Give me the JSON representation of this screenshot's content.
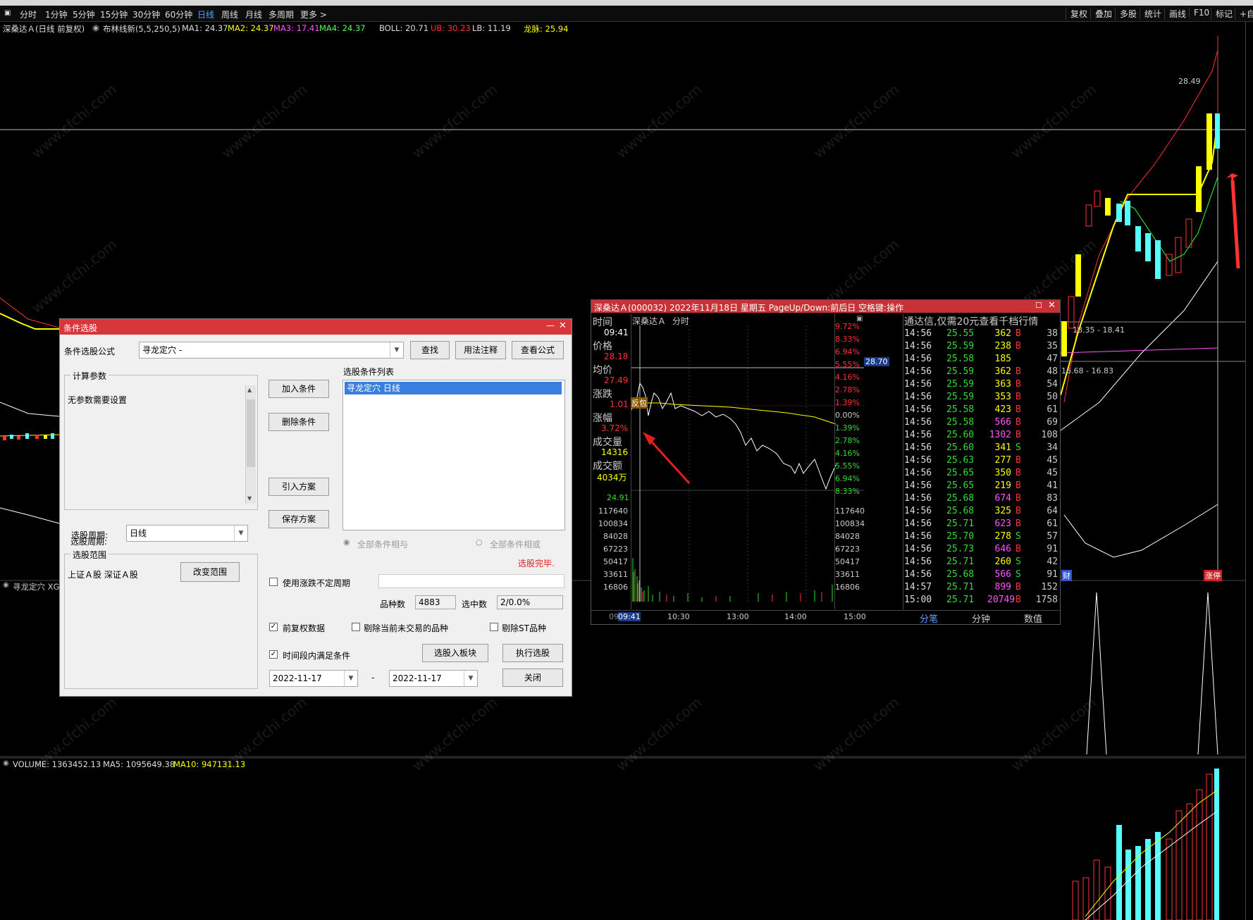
{
  "periods": [
    "分时",
    "1分钟",
    "5分钟",
    "15分钟",
    "30分钟",
    "60分钟",
    "日线",
    "周线",
    "月线",
    "多周期",
    "更多 >"
  ],
  "active_period": "日线",
  "right_tools": [
    "复权",
    "叠加",
    "多股",
    "统计",
    "画线",
    "F10",
    "标记",
    "+自"
  ],
  "info": {
    "stock": "深桑达Ａ(日线 前复权)",
    "indicator": "布林线新(5,5,250,5)",
    "ma1": "MA1: 24.37",
    "ma2": "MA2: 24.37",
    "ma3": "MA3: 17.41",
    "ma4": "MA4: 24.37",
    "boll": "BOLL: 20.71",
    "ub": "UB: 30.23",
    "lb": "LB: 11.19",
    "longmai": "龙脉: 25.94"
  },
  "chart_labels": {
    "high_price": "28.49",
    "level1": "18.35 - 18.41",
    "level2": "16.68 - 16.83",
    "cai": "财",
    "zhangting": "涨停",
    "sub_title": "寻龙定穴 XG",
    "volume_line": "VOLUME: 1363452.13",
    "ma5": "MA5: 1095649.38",
    "ma10": "MA10: 947131.13"
  },
  "colors": {
    "up": "#ff3232",
    "down": "#54ffff",
    "ma_yellow": "#ffff00",
    "dialog_title": "#d7363b"
  },
  "dialog": {
    "title": "条件选股",
    "formula_label": "条件选股公式",
    "formula_value": "寻龙定穴    -",
    "find": "查找",
    "usage": "用法注释",
    "view_formula": "查看公式",
    "params_title": "计算参数",
    "params_text": "无参数需要设置",
    "period_label": "选股周期:",
    "period_value": "日线",
    "range_title": "选股范围",
    "range_text": "上证Ａ股 深证Ａ股",
    "change_range": "改变范围",
    "add_cond": "加入条件",
    "del_cond": "删除条件",
    "import_plan": "引入方案",
    "save_plan": "保存方案",
    "cond_list_title": "选股条件列表",
    "cond_item": "寻龙定穴  日线",
    "radio_and": "全部条件相与",
    "radio_or": "全部条件相或",
    "done": "选股完毕.",
    "use_unfixed": "使用涨跌不定周期",
    "count_label": "品种数",
    "count_value": "4883",
    "selected_label": "选中数",
    "selected_value": "2/0.0%",
    "fq_data": "前复权数据",
    "exclude_untraded": "剔除当前未交易的品种",
    "exclude_st": "剔除ST品种",
    "to_block": "选股入板块",
    "execute": "执行选股",
    "period_meet": "时间段内满足条件",
    "date_from": "2022-11-17",
    "date_to": "2022-11-17",
    "close": "关闭"
  },
  "minute": {
    "title": "深桑达Ａ(000032) 2022年11月18日 星期五 PageUp/Down:前后日 空格键:操作",
    "name": "深桑达Ａ",
    "fenshi": "分时",
    "time_label": "时间",
    "time": "09:41",
    "price_label": "价格",
    "price": "28.18",
    "avg_label": "均价",
    "avg": "27.49",
    "chg_label": "涨跌",
    "chg": "1.01",
    "pct_label": "涨幅",
    "pct": "3.72%",
    "vol_label": "成交量",
    "vol": "14316",
    "amt_label": "成交额",
    "amt": "4034万",
    "left_price": "24.91",
    "vol_ticks": [
      "117640",
      "100834",
      "84028",
      "67223",
      "50417",
      "33611",
      "16806"
    ],
    "pct_ticks_up": [
      "9.72%",
      "8.33%",
      "6.94%",
      "5.55%",
      "4.16%",
      "2.78%",
      "1.39%"
    ],
    "zero_pct": "0.00%",
    "pct_ticks_down": [
      "1.39%",
      "2.78%",
      "4.16%",
      "5.55%",
      "6.94%",
      "8.33%"
    ],
    "cursor_price": "28.70",
    "times": [
      "09:41",
      "10:30",
      "13:00",
      "14:00",
      "15:00"
    ],
    "time_prefix": "09",
    "fanbao": "反包",
    "ad": "通达信,仅需20元查看千档行情",
    "ticks": [
      [
        "14:56",
        "25.55",
        "362",
        "B",
        "38"
      ],
      [
        "14:56",
        "25.59",
        "238",
        "B",
        "35"
      ],
      [
        "14:56",
        "25.58",
        "185",
        "",
        "47"
      ],
      [
        "14:56",
        "25.59",
        "362",
        "B",
        "48"
      ],
      [
        "14:56",
        "25.59",
        "363",
        "B",
        "54"
      ],
      [
        "14:56",
        "25.59",
        "353",
        "B",
        "50"
      ],
      [
        "14:56",
        "25.58",
        "423",
        "B",
        "61"
      ],
      [
        "14:56",
        "25.58",
        "566",
        "B",
        "69"
      ],
      [
        "14:56",
        "25.60",
        "1302",
        "B",
        "108"
      ],
      [
        "14:56",
        "25.60",
        "341",
        "S",
        "34"
      ],
      [
        "14:56",
        "25.63",
        "277",
        "B",
        "45"
      ],
      [
        "14:56",
        "25.65",
        "350",
        "B",
        "45"
      ],
      [
        "14:56",
        "25.65",
        "219",
        "B",
        "41"
      ],
      [
        "14:56",
        "25.68",
        "674",
        "B",
        "83"
      ],
      [
        "14:56",
        "25.68",
        "325",
        "B",
        "64"
      ],
      [
        "14:56",
        "25.71",
        "623",
        "B",
        "61"
      ],
      [
        "14:56",
        "25.70",
        "278",
        "S",
        "57"
      ],
      [
        "14:56",
        "25.73",
        "646",
        "B",
        "91"
      ],
      [
        "14:56",
        "25.71",
        "260",
        "S",
        "42"
      ],
      [
        "14:56",
        "25.68",
        "566",
        "S",
        "91"
      ],
      [
        "14:57",
        "25.71",
        "899",
        "B",
        "152"
      ],
      [
        "15:00",
        "25.71",
        "20749",
        "B",
        "1758"
      ]
    ],
    "tabs": [
      "分笔",
      "分钟",
      "数值"
    ]
  },
  "watermark": "www.cfchi.com"
}
